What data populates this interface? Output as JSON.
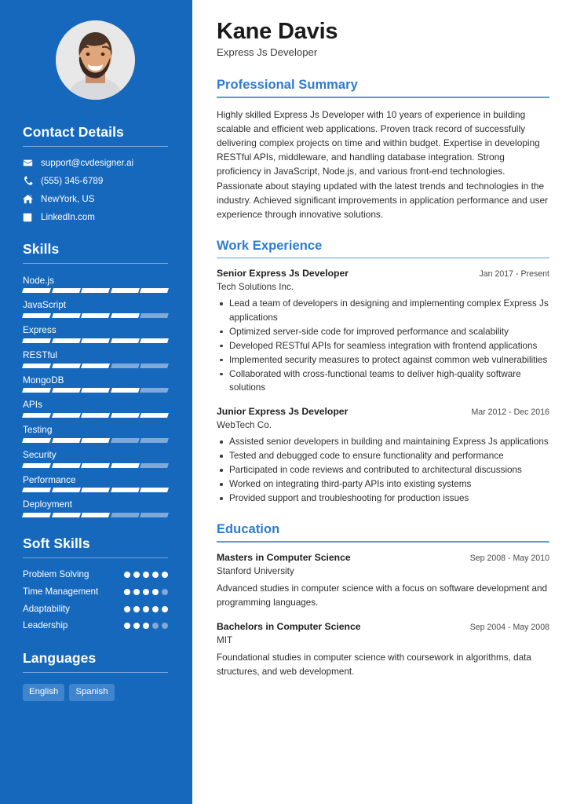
{
  "theme": {
    "sidebar_bg": "#1668bd",
    "accent": "#2b7cd3",
    "rule": "#5a9ade",
    "seg_off": "#7fa9d8",
    "tag_bg": "#3f85cd"
  },
  "sidebar": {
    "avatar_alt": "profile-photo",
    "contact": {
      "heading": "Contact Details",
      "items": [
        {
          "icon": "envelope-icon",
          "value": "support@cvdesigner.ai"
        },
        {
          "icon": "phone-icon",
          "value": "(555) 345-6789"
        },
        {
          "icon": "home-icon",
          "value": "NewYork, US"
        },
        {
          "icon": "linkedin-icon",
          "value": "LinkedIn.com"
        }
      ]
    },
    "skills": {
      "heading": "Skills",
      "max": 5,
      "items": [
        {
          "label": "Node.js",
          "level": 5
        },
        {
          "label": "JavaScript",
          "level": 4
        },
        {
          "label": "Express",
          "level": 5
        },
        {
          "label": "RESTful",
          "level": 3
        },
        {
          "label": "MongoDB",
          "level": 4
        },
        {
          "label": "APIs",
          "level": 5
        },
        {
          "label": "Testing",
          "level": 3
        },
        {
          "label": "Security",
          "level": 4
        },
        {
          "label": "Performance",
          "level": 5
        },
        {
          "label": "Deployment",
          "level": 3
        }
      ]
    },
    "soft_skills": {
      "heading": "Soft Skills",
      "max": 5,
      "items": [
        {
          "label": "Problem Solving",
          "level": 5
        },
        {
          "label": "Time Management",
          "level": 4
        },
        {
          "label": "Adaptability",
          "level": 5
        },
        {
          "label": "Leadership",
          "level": 3
        }
      ]
    },
    "languages": {
      "heading": "Languages",
      "items": [
        "English",
        "Spanish"
      ]
    }
  },
  "main": {
    "name": "Kane Davis",
    "job_title": "Express Js Developer",
    "summary": {
      "heading": "Professional Summary",
      "text": "Highly skilled Express Js Developer with 10 years of experience in building scalable and efficient web applications. Proven track record of successfully delivering complex projects on time and within budget. Expertise in developing RESTful APIs, middleware, and handling database integration. Strong proficiency in JavaScript, Node.js, and various front-end technologies. Passionate about staying updated with the latest trends and technologies in the industry. Achieved significant improvements in application performance and user experience through innovative solutions."
    },
    "work": {
      "heading": "Work Experience",
      "entries": [
        {
          "title": "Senior Express Js Developer",
          "date": "Jan 2017 - Present",
          "org": "Tech Solutions Inc.",
          "bullets": [
            "Lead a team of developers in designing and implementing complex Express Js applications",
            "Optimized server-side code for improved performance and scalability",
            "Developed RESTful APIs for seamless integration with frontend applications",
            "Implemented security measures to protect against common web vulnerabilities",
            "Collaborated with cross-functional teams to deliver high-quality software solutions"
          ]
        },
        {
          "title": "Junior Express Js Developer",
          "date": "Mar 2012 - Dec 2016",
          "org": "WebTech Co.",
          "bullets": [
            "Assisted senior developers in building and maintaining Express Js applications",
            "Tested and debugged code to ensure functionality and performance",
            "Participated in code reviews and contributed to architectural discussions",
            "Worked on integrating third-party APIs into existing systems",
            "Provided support and troubleshooting for production issues"
          ]
        }
      ]
    },
    "education": {
      "heading": "Education",
      "entries": [
        {
          "title": "Masters in Computer Science",
          "date": "Sep 2008 - May 2010",
          "org": "Stanford University",
          "description": "Advanced studies in computer science with a focus on software development and programming languages."
        },
        {
          "title": "Bachelors in Computer Science",
          "date": "Sep 2004 - May 2008",
          "org": "MIT",
          "description": "Foundational studies in computer science with coursework in algorithms, data structures, and web development."
        }
      ]
    }
  }
}
